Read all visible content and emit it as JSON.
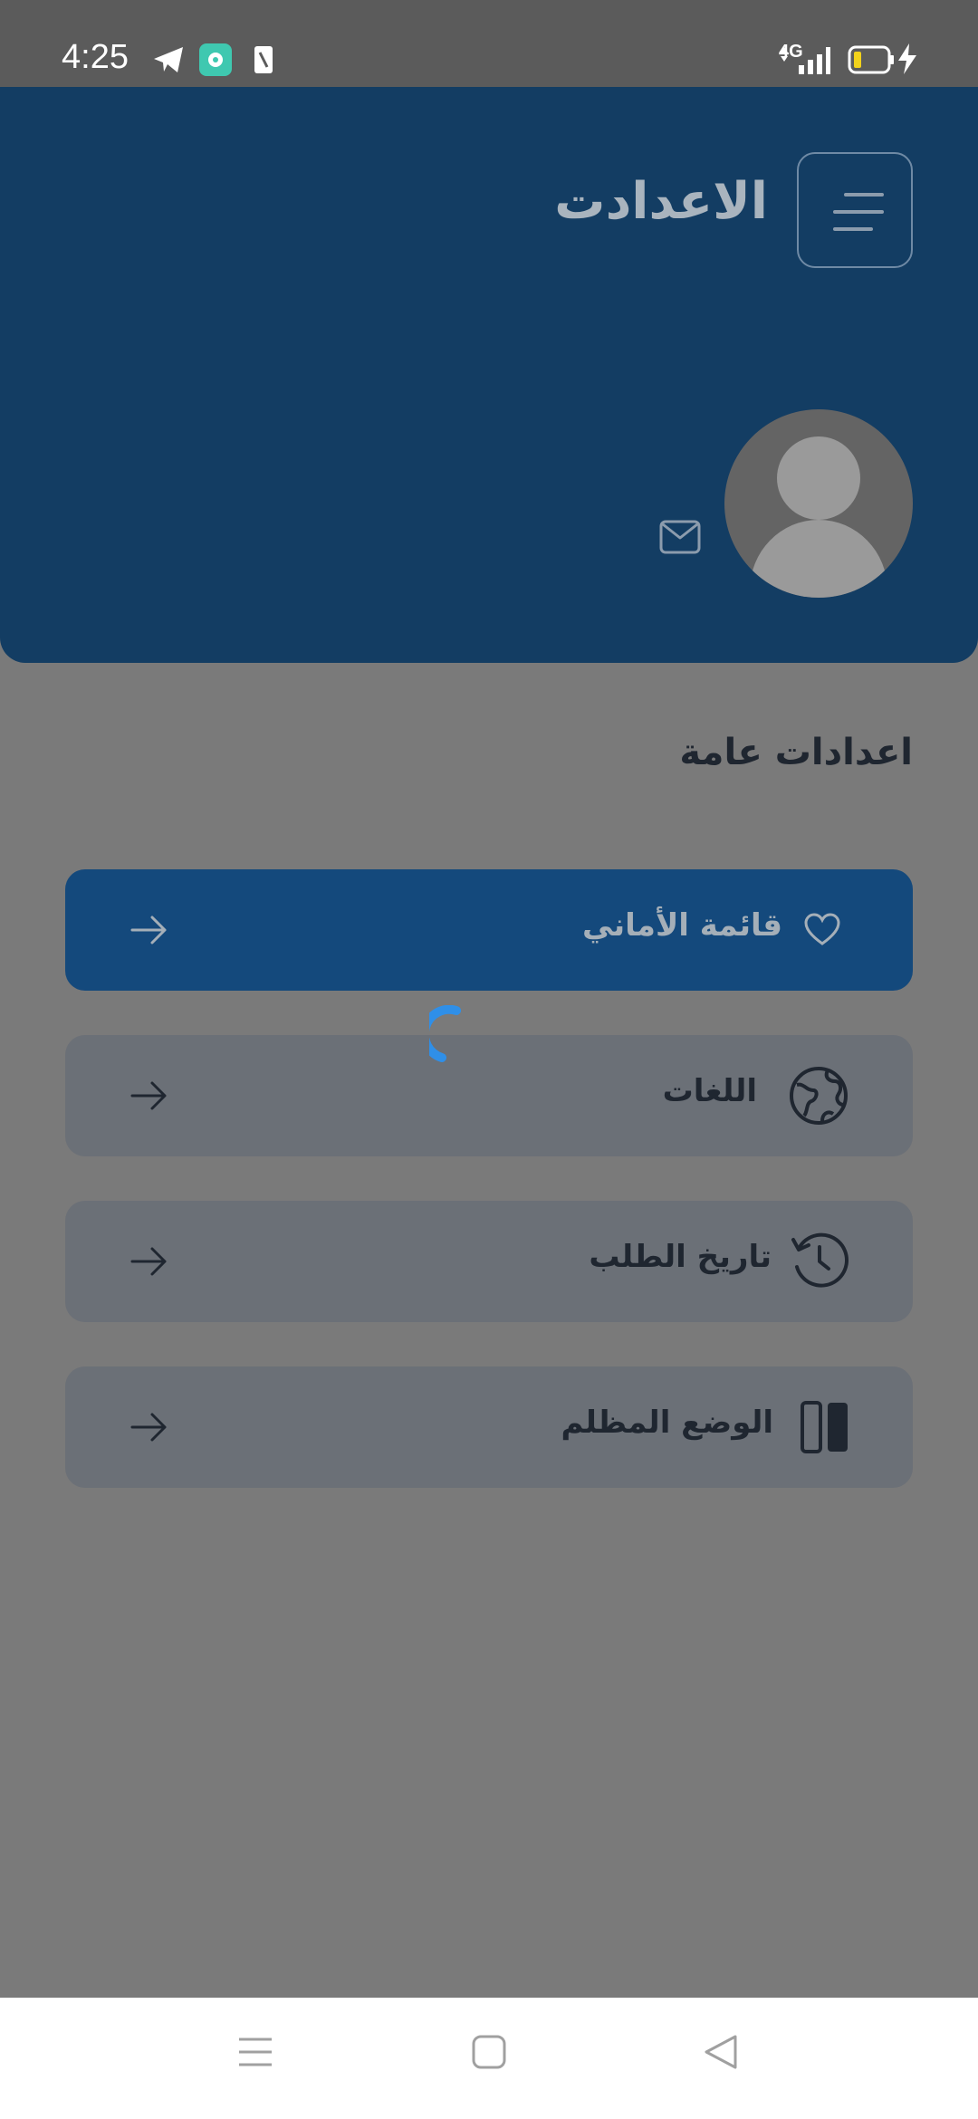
{
  "status_bar": {
    "time": "4:25",
    "network": "4G",
    "icons": [
      "telegram-icon",
      "app-notification-icon",
      "sim-icon",
      "signal-icon",
      "battery-icon",
      "charging-icon"
    ]
  },
  "header": {
    "title": "الاعدادت",
    "menu_icon": "menu-icon",
    "avatar_icon": "user-avatar-icon",
    "mail_icon": "mail-icon"
  },
  "section": {
    "title": "اعدادات عامة"
  },
  "settings_items": [
    {
      "label": "قائمة الأماني",
      "icon": "heart-icon",
      "active": true
    },
    {
      "label": "اللغات",
      "icon": "globe-icon",
      "active": false
    },
    {
      "label": "تاريخ الطلب",
      "icon": "history-icon",
      "active": false
    },
    {
      "label": "الوضع المظلم",
      "icon": "dark-mode-icon",
      "active": false
    }
  ],
  "nav_bar": {
    "buttons": [
      "recent-apps-icon",
      "home-icon",
      "back-icon"
    ]
  },
  "colors": {
    "header_bg": "#133d63",
    "active_row": "#14497c",
    "row_bg": "#6b7077",
    "overlay_bg": "#7a7a7a",
    "spinner": "#2f8fe8"
  }
}
